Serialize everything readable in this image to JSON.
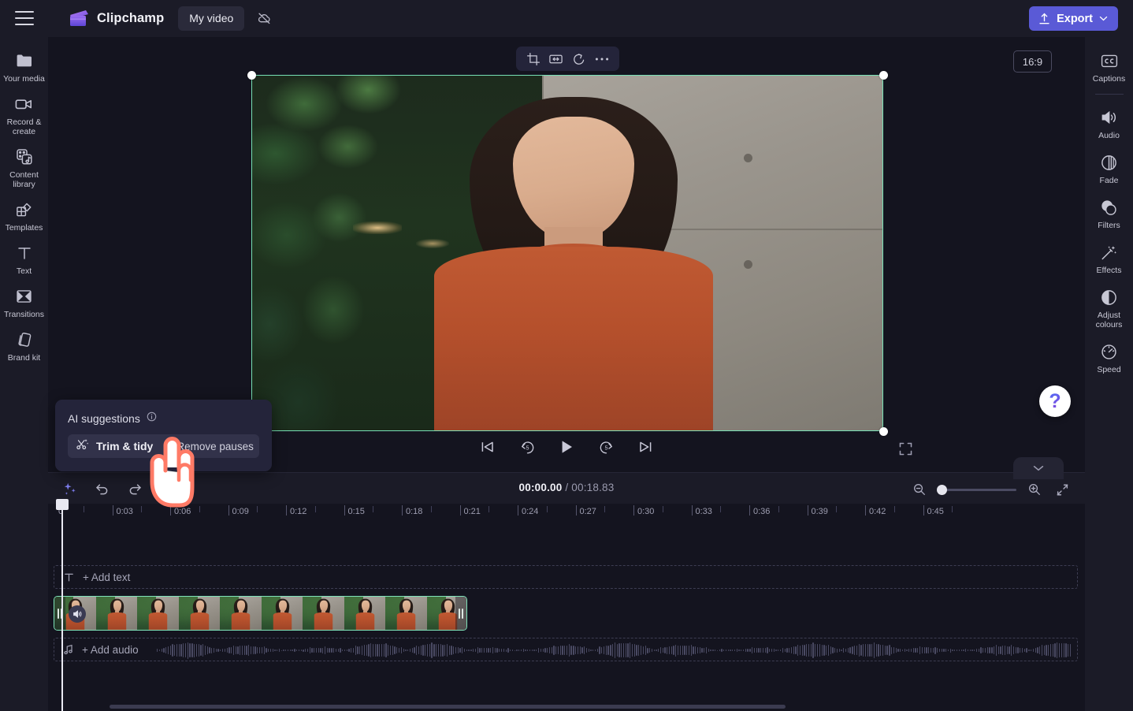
{
  "app": {
    "brand": "Clipchamp",
    "project_name": "My video",
    "menu_icon": "hamburger-icon",
    "cloud_icon": "cloud-off-icon",
    "export_label": "Export",
    "export_icon": "upload-icon",
    "export_chevron": "chevron-down-icon",
    "export_color": "#5a5ad6"
  },
  "left_rail": {
    "items": [
      {
        "label": "Your media",
        "icon": "folder-icon"
      },
      {
        "label": "Record & create",
        "icon": "video-camera-icon"
      },
      {
        "label": "Content library",
        "icon": "content-library-icon"
      },
      {
        "label": "Templates",
        "icon": "templates-icon"
      },
      {
        "label": "Text",
        "icon": "text-icon"
      },
      {
        "label": "Transitions",
        "icon": "transitions-icon"
      },
      {
        "label": "Brand kit",
        "icon": "brand-kit-icon"
      }
    ],
    "collapse_icon": "chevron-right-icon"
  },
  "right_rail": {
    "items": [
      {
        "label": "Captions",
        "icon": "closed-captions-icon"
      },
      {
        "label": "Audio",
        "icon": "speaker-icon"
      },
      {
        "label": "Fade",
        "icon": "fade-icon"
      },
      {
        "label": "Filters",
        "icon": "filters-icon"
      },
      {
        "label": "Effects",
        "icon": "magic-wand-icon"
      },
      {
        "label": "Adjust colours",
        "icon": "contrast-icon"
      },
      {
        "label": "Speed",
        "icon": "speedometer-icon"
      }
    ],
    "collapse_icon": "chevron-left-icon"
  },
  "preview": {
    "float_tools": [
      {
        "name": "crop-icon"
      },
      {
        "name": "flip-icon"
      },
      {
        "name": "rotate-icon"
      },
      {
        "name": "more-options-icon"
      }
    ],
    "aspect_ratio": "16:9",
    "selection_color": "#77e0b5",
    "fullscreen_icon": "fullscreen-icon",
    "help_label": "?",
    "panel_tab_icon": "chevron-down-icon"
  },
  "playback": {
    "buttons": [
      {
        "name": "skip-to-start-button",
        "icon": "skip-start-icon"
      },
      {
        "name": "rewind-5-button",
        "icon": "rewind-5-icon"
      },
      {
        "name": "play-button",
        "icon": "play-icon"
      },
      {
        "name": "forward-5-button",
        "icon": "forward-5-icon"
      },
      {
        "name": "skip-to-end-button",
        "icon": "skip-end-icon"
      }
    ]
  },
  "ai_suggestions": {
    "title": "AI suggestions",
    "info_icon": "info-icon",
    "trim_label": "Trim & tidy",
    "trim_icon": "trim-tidy-icon",
    "remove_pauses_label": "Remove pauses"
  },
  "timeline_toolbar": {
    "buttons": [
      {
        "name": "ai-suggestions-button",
        "icon": "sparkle-icon"
      },
      {
        "name": "undo-button",
        "icon": "undo-icon"
      },
      {
        "name": "redo-button",
        "icon": "redo-icon"
      },
      {
        "name": "split-button",
        "icon": "scissors-icon"
      }
    ],
    "current_time": "00:00.00",
    "time_separator": " / ",
    "total_time": "00:18.83",
    "zoom_out_icon": "zoom-out-icon",
    "zoom_in_icon": "zoom-in-icon",
    "fit_icon": "fit-to-screen-icon",
    "zoom_value": 0
  },
  "timeline": {
    "ruler_labels": [
      "0",
      "0:03",
      "0:06",
      "0:09",
      "0:12",
      "0:15",
      "0:18",
      "0:21",
      "0:24",
      "0:27",
      "0:30",
      "0:33",
      "0:36",
      "0:39",
      "0:42",
      "0:45"
    ],
    "text_track": {
      "label": "+ Add text",
      "icon": "text-icon"
    },
    "audio_track": {
      "label": "+ Add audio",
      "icon": "music-note-icon"
    },
    "clip": {
      "name": "video-clip",
      "selected": true,
      "border_color": "#7fe3ba",
      "audio_icon": "speaker-icon",
      "thumbnail_count": 10
    }
  },
  "cursor": {
    "icon": "hand-pointer-cursor",
    "color": "#ff7a66"
  }
}
